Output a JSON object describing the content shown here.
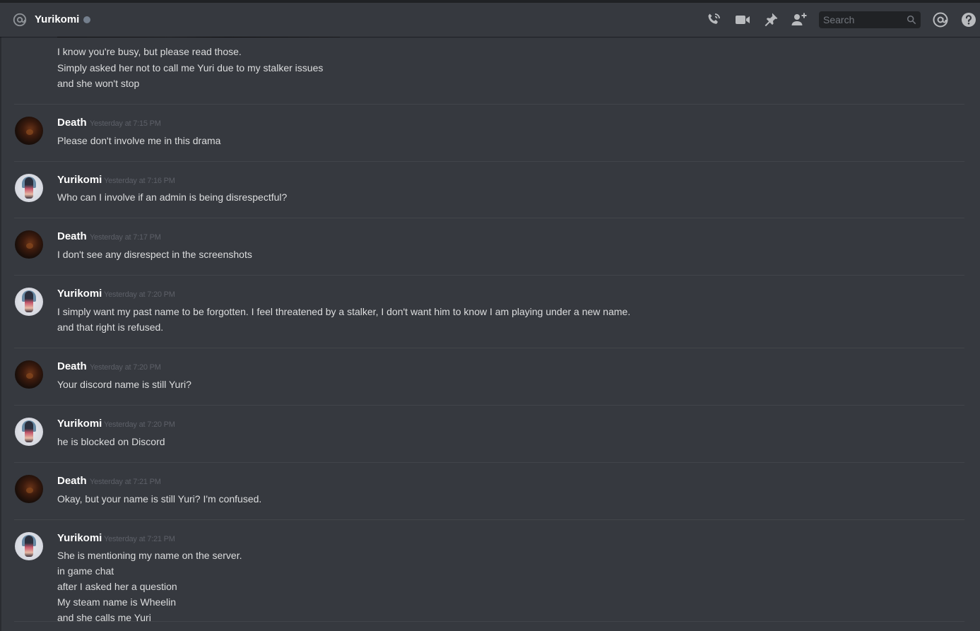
{
  "header": {
    "dm_user": "Yurikomi",
    "search_placeholder": "Search",
    "icons": [
      "at-icon",
      "status-dot",
      "voice-call-icon",
      "video-call-icon",
      "pin-icon",
      "add-friend-icon",
      "search-icon",
      "mentions-icon",
      "help-icon"
    ]
  },
  "colors": {
    "background": "#36393f",
    "username": "#ffffff",
    "message_text": "#dcddde",
    "timestamp": "#5d6068",
    "status_offline": "#747f8d",
    "search_bg": "#202225"
  },
  "messages": {
    "first_group": {
      "lines": [
        "I know you're busy, but please read those.",
        "Simply asked her not to call me Yuri due to my stalker issues",
        "and she won't stop"
      ]
    },
    "groups": [
      {
        "author": "Death",
        "timestamp": "Yesterday at 7:15 PM",
        "lines": [
          "Please don't involve me in this drama"
        ]
      },
      {
        "author": "Yurikomi",
        "timestamp": "Yesterday at 7:16 PM",
        "lines": [
          "Who can I involve if an admin is being disrespectful?"
        ]
      },
      {
        "author": "Death",
        "timestamp": "Yesterday at 7:17 PM",
        "lines": [
          "I don't see any disrespect in the screenshots"
        ]
      },
      {
        "author": "Yurikomi",
        "timestamp": "Yesterday at 7:20 PM",
        "lines": [
          "I simply want my past name to be forgotten. I feel threatened by a stalker, I don't want him to know I am playing under a new name.",
          "and that right is refused."
        ]
      },
      {
        "author": "Death",
        "timestamp": "Yesterday at 7:20 PM",
        "lines": [
          "Your discord name is still Yuri?"
        ]
      },
      {
        "author": "Yurikomi",
        "timestamp": "Yesterday at 7:20 PM",
        "lines": [
          "he is blocked on Discord"
        ]
      },
      {
        "author": "Death",
        "timestamp": "Yesterday at 7:21 PM",
        "lines": [
          "Okay, but your name is still Yuri? I'm confused."
        ]
      },
      {
        "author": "Yurikomi",
        "timestamp": "Yesterday at 7:21 PM",
        "lines": [
          "She is mentioning my name on the server.",
          "in game chat",
          "after I asked her a question",
          "My steam name is Wheelin",
          "and she calls me Yuri"
        ]
      }
    ]
  }
}
